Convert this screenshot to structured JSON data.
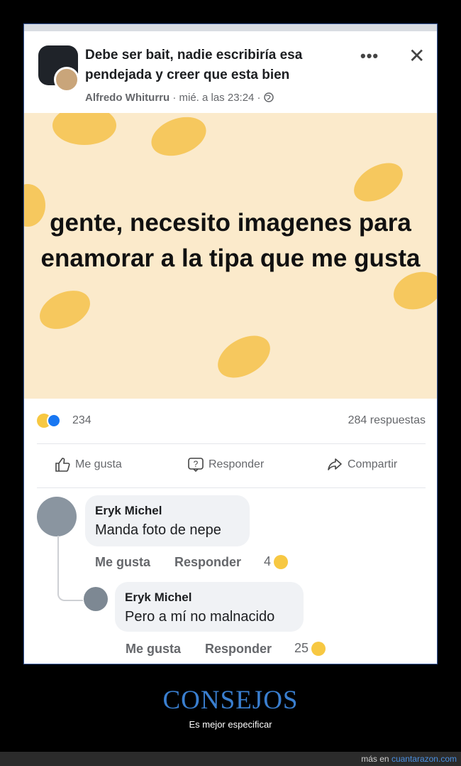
{
  "post": {
    "title": "Debe ser bait, nadie escribiría esa pendejada y creer que esta bien",
    "author": "Alfredo Whiturru",
    "time": "· mié. a las 23:24 ·",
    "globe_icon": "globe-icon",
    "more_icon": "•••",
    "close_icon": "✕",
    "body_text": "gente, necesito imagenes para enamorar a la tipa que me gusta",
    "background_colors": {
      "base": "#fbeacb",
      "blob": "#f5c452"
    }
  },
  "stats": {
    "reaction_count": "234",
    "replies": "284 respuestas"
  },
  "actions": {
    "like": "Me gusta",
    "reply": "Responder",
    "share": "Compartir"
  },
  "comments": [
    {
      "name": "Eryk Michel",
      "text": "Manda foto de nepe",
      "like_label": "Me gusta",
      "reply_label": "Responder",
      "reaction_count": "4"
    },
    {
      "name": "Eryk Michel",
      "text": "Pero a mí no malnacido",
      "like_label": "Me gusta",
      "reply_label": "Responder",
      "reaction_count": "25"
    }
  ],
  "caption": {
    "title": "CONSEJOS",
    "subtitle": "Es mejor especificar"
  },
  "footer": {
    "prefix": "más en ",
    "site": "cuantarazon.com"
  },
  "colors": {
    "accent": "#1877f2",
    "caption_blue": "#3a7fd0",
    "haha": "#f7c842"
  }
}
